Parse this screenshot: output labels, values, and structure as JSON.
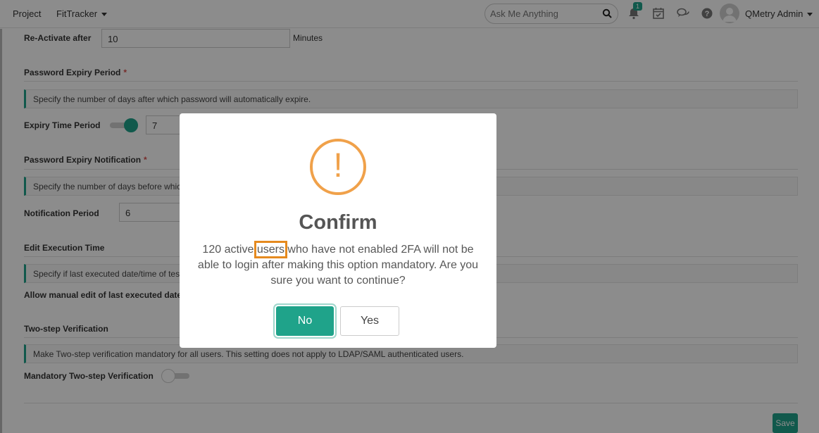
{
  "topbar": {
    "project_label": "Project",
    "project_name": "FitTracker",
    "search_placeholder": "Ask Me Anything",
    "notification_count": "1",
    "user_name": "QMetry Admin"
  },
  "settings": {
    "reactivate": {
      "label": "Re-Activate after",
      "value": "10",
      "unit": "Minutes"
    },
    "password_expiry": {
      "section_title": "Password Expiry Period",
      "info": "Specify the number of days after which password will automatically expire.",
      "field_label": "Expiry Time Period",
      "toggle_on": true,
      "value": "7"
    },
    "expiry_notification": {
      "section_title": "Password Expiry Notification",
      "info": "Specify the number of days before which",
      "field_label": "Notification Period",
      "value": "6"
    },
    "edit_execution": {
      "section_title": "Edit Execution Time",
      "info": "Specify if last executed date/time of test",
      "field_label": "Allow manual edit of last executed date/"
    },
    "two_step": {
      "section_title": "Two-step Verification",
      "info": "Make Two-step verification mandatory for all users. This setting does not apply to LDAP/SAML authenticated users.",
      "field_label": "Mandatory Two-step Verification",
      "toggle_on": false
    },
    "save_label": "Save"
  },
  "modal": {
    "icon": "exclamation-icon",
    "title": "Confirm",
    "message_before": "120 active ",
    "message_highlight": "users",
    "message_after": " who have not enabled 2FA will not be able to login after making this option mandatory. Are you sure you want to continue?",
    "no_label": "No",
    "yes_label": "Yes"
  },
  "colors": {
    "accent": "#1fa38a",
    "warning": "#f0a14a",
    "highlight": "#e58a1f"
  }
}
